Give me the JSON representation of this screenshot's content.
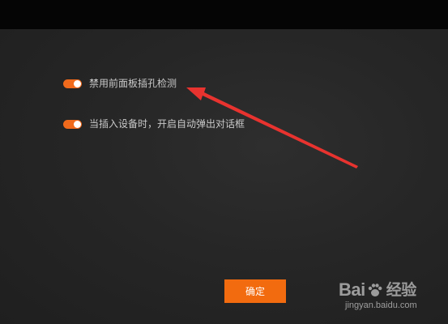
{
  "settings": {
    "options": [
      {
        "label": "禁用前面板插孔检测",
        "enabled": true
      },
      {
        "label": "当插入设备时，开启自动弹出对话框",
        "enabled": true
      }
    ],
    "confirm_label": "确定"
  },
  "watermark": {
    "brand_left": "Bai",
    "brand_right": "经验",
    "url": "jingyan.baidu.com"
  },
  "colors": {
    "accent": "#f26b0f",
    "annotation_arrow": "#e8332f",
    "background": "#262626"
  }
}
